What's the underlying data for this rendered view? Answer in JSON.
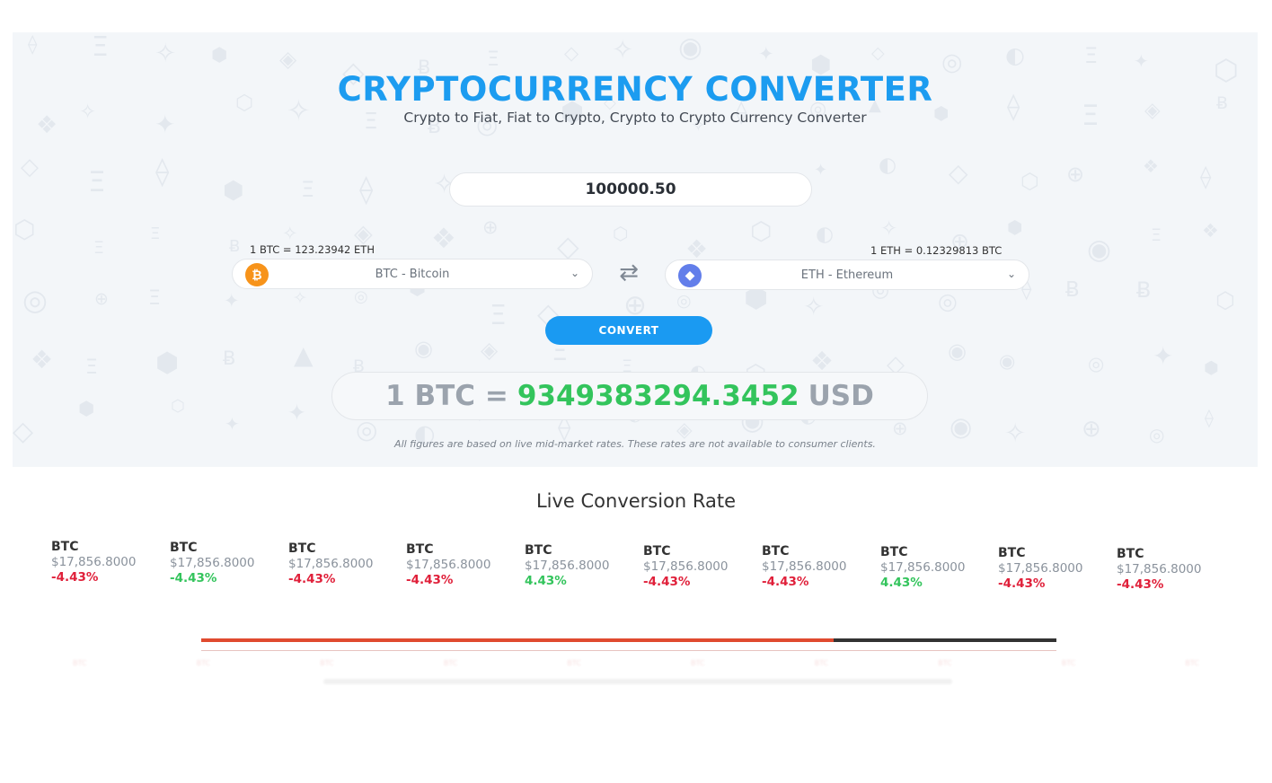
{
  "hero": {
    "title": "CRYPTOCURRENCY CONVERTER",
    "subtitle": "Crypto to Fiat, Fiat to Crypto, Crypto to Crypto Currency Converter",
    "amount": "100000.50",
    "from_rate_note": "1 BTC = 123.23942 ETH",
    "to_rate_note": "1 ETH = 0.12329813 BTC",
    "from_select": {
      "label": "BTC - Bitcoin",
      "icon": "bitcoin-icon",
      "color": "#f7931a",
      "glyph": "₿"
    },
    "to_select": {
      "label": "ETH - Ethereum",
      "icon": "ethereum-icon",
      "color": "#627eea",
      "glyph": "◆"
    },
    "swap_icon": "swap-arrows-icon",
    "convert_label": "CONVERT",
    "result": {
      "lhs": "1 BTC =",
      "value": "9349383294.3452",
      "unit": "USD"
    },
    "disclaimer": "All figures are based on live mid-market rates. These rates are not available to consumer clients."
  },
  "live": {
    "title": "Live Conversion Rate",
    "items": [
      {
        "symbol": "BTC",
        "price": "$17,856.8000",
        "change": "-4.43%",
        "direction": "down"
      },
      {
        "symbol": "BTC",
        "price": "$17,856.8000",
        "change": "-4.43%",
        "direction": "up"
      },
      {
        "symbol": "BTC",
        "price": "$17,856.8000",
        "change": "-4.43%",
        "direction": "down"
      },
      {
        "symbol": "BTC",
        "price": "$17,856.8000",
        "change": "-4.43%",
        "direction": "down"
      },
      {
        "symbol": "BTC",
        "price": "$17,856.8000",
        "change": "4.43%",
        "direction": "up"
      },
      {
        "symbol": "BTC",
        "price": "$17,856.8000",
        "change": "-4.43%",
        "direction": "down"
      },
      {
        "symbol": "BTC",
        "price": "$17,856.8000",
        "change": "-4.43%",
        "direction": "down"
      },
      {
        "symbol": "BTC",
        "price": "$17,856.8000",
        "change": "4.43%",
        "direction": "up"
      },
      {
        "symbol": "BTC",
        "price": "$17,856.8000",
        "change": "-4.43%",
        "direction": "down"
      },
      {
        "symbol": "BTC",
        "price": "$17,856.8000",
        "change": "-4.43%",
        "direction": "down"
      }
    ],
    "carousel_progress": 0.74
  },
  "colors": {
    "accent": "#1a9af2",
    "positive": "#33c45c",
    "negative": "#e0203a",
    "progress": "#e04a2f"
  }
}
